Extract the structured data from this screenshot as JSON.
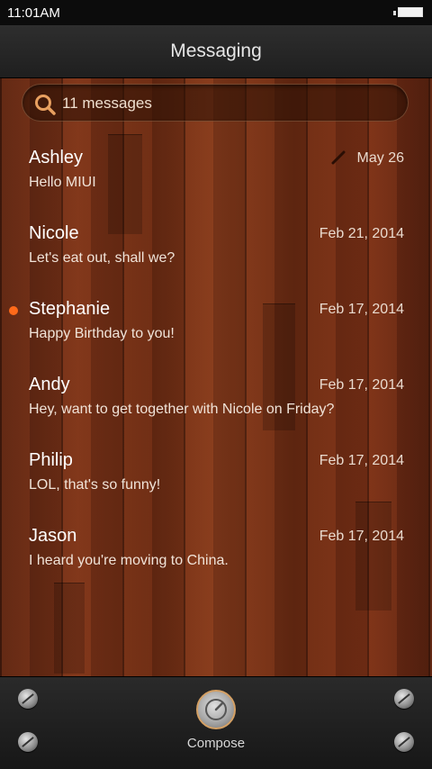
{
  "status_bar": {
    "time": "11:01AM"
  },
  "header": {
    "title": "Messaging"
  },
  "search": {
    "count_label": "11 messages"
  },
  "threads": [
    {
      "name": "Ashley",
      "preview": "Hello MIUI",
      "date": "May 26",
      "draft": true,
      "unread": false
    },
    {
      "name": "Nicole",
      "preview": "Let's eat out, shall we?",
      "date": "Feb 21, 2014",
      "draft": false,
      "unread": false
    },
    {
      "name": "Stephanie",
      "preview": "Happy Birthday to you!",
      "date": "Feb 17, 2014",
      "draft": false,
      "unread": true
    },
    {
      "name": "Andy",
      "preview": "Hey, want to get together with Nicole on Friday?",
      "date": "Feb 17, 2014",
      "draft": false,
      "unread": false
    },
    {
      "name": "Philip",
      "preview": "LOL, that's so funny!",
      "date": "Feb 17, 2014",
      "draft": false,
      "unread": false
    },
    {
      "name": "Jason",
      "preview": "I heard you're moving to China.",
      "date": "Feb 17, 2014",
      "draft": false,
      "unread": false
    }
  ],
  "bottom_bar": {
    "compose_label": "Compose"
  },
  "colors": {
    "unread_dot": "#ff6a1a",
    "wood": "#6a2a12",
    "compose_ring": "#d4a064"
  },
  "icons": {
    "search": "search-icon",
    "draft": "pencil-icon",
    "compose": "compose-icon"
  }
}
